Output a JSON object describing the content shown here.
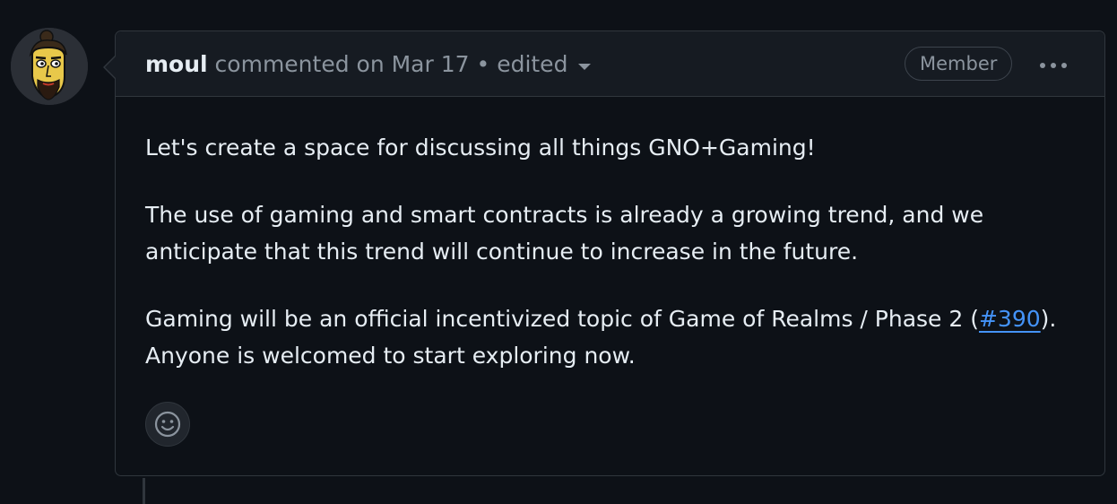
{
  "comment": {
    "author": "moul",
    "action_text": "commented on Mar 17",
    "separator": "•",
    "edited_label": "edited",
    "badge": "Member",
    "more_options_icon": "kebab-horizontal-icon",
    "body": {
      "p1": "Let's create a space for discussing all things GNO+Gaming!",
      "p2": "The use of gaming and smart contracts is already a growing trend, and we anticipate that this trend will continue to increase in the future.",
      "p3_before": "Gaming will be an official incentivized topic of Game of Realms / Phase 2 (",
      "p3_link": "#390",
      "p3_after": "). Anyone is welcomed to start exploring now."
    },
    "reaction_icon": "smiley-icon"
  },
  "colors": {
    "background": "#0d1117",
    "header_background": "#161b22",
    "border": "#30363d",
    "text": "#e6edf3",
    "muted": "#8b949e",
    "link": "#4493f8"
  }
}
